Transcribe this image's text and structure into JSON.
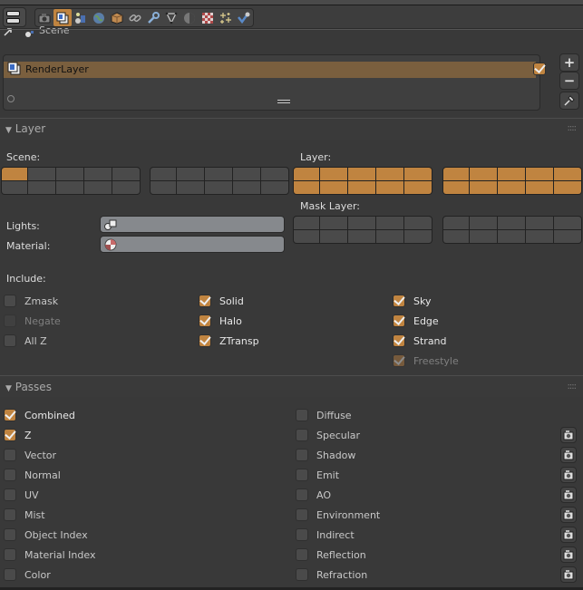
{
  "header": {
    "tabs": [
      {
        "name": "render-tab",
        "icon": "camera-icon",
        "active": false
      },
      {
        "name": "render-layers-tab",
        "icon": "render-layers-icon",
        "active": true
      },
      {
        "name": "scene-tab",
        "icon": "scene-icon",
        "active": false
      },
      {
        "name": "world-tab",
        "icon": "world-icon",
        "active": false
      },
      {
        "name": "object-tab",
        "icon": "cube-icon",
        "active": false
      },
      {
        "name": "constraints-tab",
        "icon": "link-icon",
        "active": false
      },
      {
        "name": "modifiers-tab",
        "icon": "wrench-icon",
        "active": false
      },
      {
        "name": "data-tab",
        "icon": "mesh-data-icon",
        "active": false
      },
      {
        "name": "material-tab",
        "icon": "material-icon",
        "active": false
      },
      {
        "name": "texture-tab",
        "icon": "texture-icon",
        "active": false
      },
      {
        "name": "particles-tab",
        "icon": "particles-icon",
        "active": false
      },
      {
        "name": "physics-tab",
        "icon": "physics-icon",
        "active": false
      }
    ],
    "breadcrumb": "Scene"
  },
  "render_layers": {
    "items": [
      {
        "label": "RenderLayer",
        "enabled": true
      }
    ],
    "add_label": "+",
    "remove_label": "−"
  },
  "layer_panel": {
    "title": "Layer",
    "scene_label": "Scene:",
    "layer_label": "Layer:",
    "mask_layer_label": "Mask Layer:",
    "lights_label": "Lights:",
    "material_label": "Material:",
    "lights_value": "",
    "material_value": "",
    "include_label": "Include:",
    "scene_layers_active": [
      0
    ],
    "layer_all_active": true,
    "include": {
      "col1": [
        {
          "label": "Zmask",
          "checked": false,
          "enabled": true
        },
        {
          "label": "Negate",
          "checked": false,
          "enabled": false
        },
        {
          "label": "All Z",
          "checked": false,
          "enabled": true
        }
      ],
      "col2": [
        {
          "label": "Solid",
          "checked": true,
          "enabled": true
        },
        {
          "label": "Halo",
          "checked": true,
          "enabled": true
        },
        {
          "label": "ZTransp",
          "checked": true,
          "enabled": true
        }
      ],
      "col3": [
        {
          "label": "Sky",
          "checked": true,
          "enabled": true
        },
        {
          "label": "Edge",
          "checked": true,
          "enabled": true
        },
        {
          "label": "Strand",
          "checked": true,
          "enabled": true
        },
        {
          "label": "Freestyle",
          "checked": true,
          "enabled": false
        }
      ]
    }
  },
  "passes_panel": {
    "title": "Passes",
    "left": [
      {
        "label": "Combined",
        "checked": true
      },
      {
        "label": "Z",
        "checked": true
      },
      {
        "label": "Vector",
        "checked": false
      },
      {
        "label": "Normal",
        "checked": false
      },
      {
        "label": "UV",
        "checked": false
      },
      {
        "label": "Mist",
        "checked": false
      },
      {
        "label": "Object Index",
        "checked": false
      },
      {
        "label": "Material Index",
        "checked": false
      },
      {
        "label": "Color",
        "checked": false
      }
    ],
    "right": [
      {
        "label": "Diffuse",
        "checked": false,
        "exclude_toggle": false
      },
      {
        "label": "Specular",
        "checked": false,
        "exclude_toggle": true
      },
      {
        "label": "Shadow",
        "checked": false,
        "exclude_toggle": true
      },
      {
        "label": "Emit",
        "checked": false,
        "exclude_toggle": true
      },
      {
        "label": "AO",
        "checked": false,
        "exclude_toggle": true
      },
      {
        "label": "Environment",
        "checked": false,
        "exclude_toggle": true
      },
      {
        "label": "Indirect",
        "checked": false,
        "exclude_toggle": true
      },
      {
        "label": "Reflection",
        "checked": false,
        "exclude_toggle": true
      },
      {
        "label": "Refraction",
        "checked": false,
        "exclude_toggle": true
      }
    ]
  }
}
